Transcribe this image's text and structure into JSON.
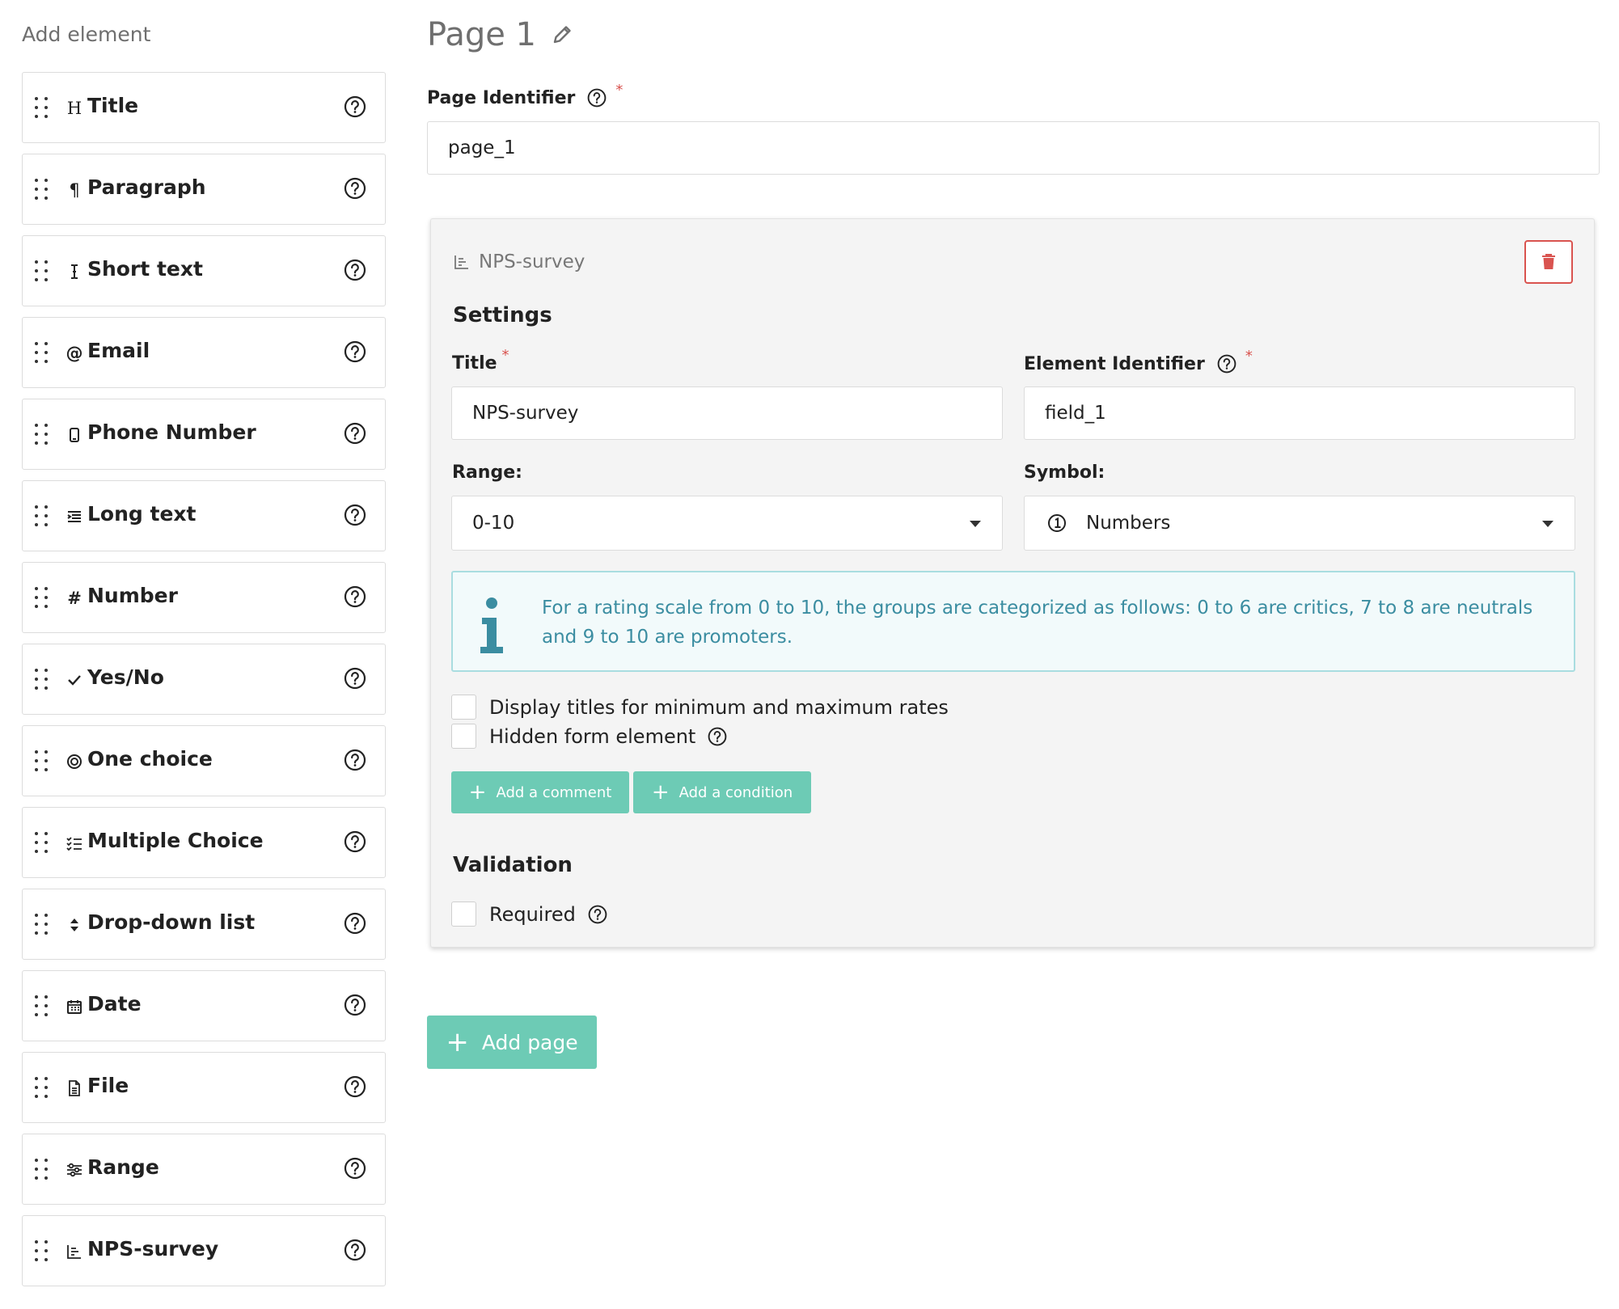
{
  "sidebar": {
    "title": "Add element",
    "items": [
      {
        "label": "Title",
        "icon": "heading-icon"
      },
      {
        "label": "Paragraph",
        "icon": "paragraph-icon"
      },
      {
        "label": "Short text",
        "icon": "text-cursor-icon"
      },
      {
        "label": "Email",
        "icon": "at-icon"
      },
      {
        "label": "Phone Number",
        "icon": "phone-icon"
      },
      {
        "label": "Long text",
        "icon": "long-text-icon"
      },
      {
        "label": "Number",
        "icon": "hash-icon"
      },
      {
        "label": "Yes/No",
        "icon": "check-icon"
      },
      {
        "label": "One choice",
        "icon": "radio-icon"
      },
      {
        "label": "Multiple Choice",
        "icon": "checklist-icon"
      },
      {
        "label": "Drop-down list",
        "icon": "sort-icon"
      },
      {
        "label": "Date",
        "icon": "calendar-icon"
      },
      {
        "label": "File",
        "icon": "file-icon"
      },
      {
        "label": "Range",
        "icon": "sliders-icon"
      },
      {
        "label": "NPS-survey",
        "icon": "chart-icon"
      }
    ]
  },
  "page": {
    "title": "Page 1",
    "identifier_label": "Page Identifier",
    "identifier_value": "page_1",
    "required_mark": "*"
  },
  "element": {
    "type_label": "NPS-survey",
    "settings_title": "Settings",
    "title_label": "Title",
    "title_value": "NPS-survey",
    "id_label": "Element Identifier",
    "id_value": "field_1",
    "range_label": "Range:",
    "range_value": "0-10",
    "symbol_label": "Symbol:",
    "symbol_value": "Numbers",
    "info_text": "For a rating scale from 0 to 10, the groups are categorized as follows: 0 to 6 are critics, 7 to 8 are neutrals and 9 to 10 are promoters.",
    "display_titles_label": "Display titles for minimum and maximum rates",
    "hidden_label": "Hidden form element",
    "add_comment_label": "Add a comment",
    "add_condition_label": "Add a condition",
    "validation_title": "Validation",
    "required_label": "Required"
  },
  "add_page_label": "Add page",
  "colors": {
    "accent": "#6dcbb5",
    "danger": "#d9534f",
    "info_text": "#3b8da1",
    "info_border": "#a9dde0"
  }
}
